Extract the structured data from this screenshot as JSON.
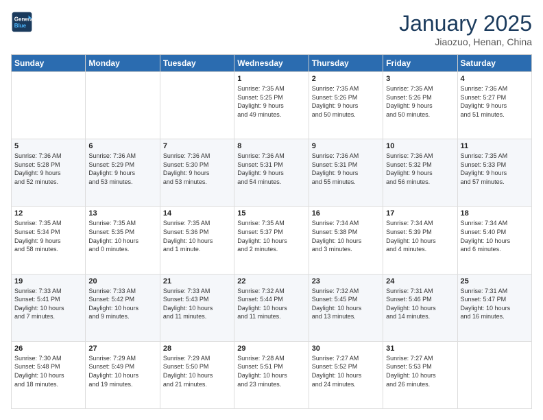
{
  "header": {
    "logo_line1": "General",
    "logo_line2": "Blue",
    "title": "January 2025",
    "subtitle": "Jiaozuo, Henan, China"
  },
  "weekdays": [
    "Sunday",
    "Monday",
    "Tuesday",
    "Wednesday",
    "Thursday",
    "Friday",
    "Saturday"
  ],
  "weeks": [
    [
      {
        "day": "",
        "info": ""
      },
      {
        "day": "",
        "info": ""
      },
      {
        "day": "",
        "info": ""
      },
      {
        "day": "1",
        "info": "Sunrise: 7:35 AM\nSunset: 5:25 PM\nDaylight: 9 hours\nand 49 minutes."
      },
      {
        "day": "2",
        "info": "Sunrise: 7:35 AM\nSunset: 5:26 PM\nDaylight: 9 hours\nand 50 minutes."
      },
      {
        "day": "3",
        "info": "Sunrise: 7:35 AM\nSunset: 5:26 PM\nDaylight: 9 hours\nand 50 minutes."
      },
      {
        "day": "4",
        "info": "Sunrise: 7:36 AM\nSunset: 5:27 PM\nDaylight: 9 hours\nand 51 minutes."
      }
    ],
    [
      {
        "day": "5",
        "info": "Sunrise: 7:36 AM\nSunset: 5:28 PM\nDaylight: 9 hours\nand 52 minutes."
      },
      {
        "day": "6",
        "info": "Sunrise: 7:36 AM\nSunset: 5:29 PM\nDaylight: 9 hours\nand 53 minutes."
      },
      {
        "day": "7",
        "info": "Sunrise: 7:36 AM\nSunset: 5:30 PM\nDaylight: 9 hours\nand 53 minutes."
      },
      {
        "day": "8",
        "info": "Sunrise: 7:36 AM\nSunset: 5:31 PM\nDaylight: 9 hours\nand 54 minutes."
      },
      {
        "day": "9",
        "info": "Sunrise: 7:36 AM\nSunset: 5:31 PM\nDaylight: 9 hours\nand 55 minutes."
      },
      {
        "day": "10",
        "info": "Sunrise: 7:36 AM\nSunset: 5:32 PM\nDaylight: 9 hours\nand 56 minutes."
      },
      {
        "day": "11",
        "info": "Sunrise: 7:35 AM\nSunset: 5:33 PM\nDaylight: 9 hours\nand 57 minutes."
      }
    ],
    [
      {
        "day": "12",
        "info": "Sunrise: 7:35 AM\nSunset: 5:34 PM\nDaylight: 9 hours\nand 58 minutes."
      },
      {
        "day": "13",
        "info": "Sunrise: 7:35 AM\nSunset: 5:35 PM\nDaylight: 10 hours\nand 0 minutes."
      },
      {
        "day": "14",
        "info": "Sunrise: 7:35 AM\nSunset: 5:36 PM\nDaylight: 10 hours\nand 1 minute."
      },
      {
        "day": "15",
        "info": "Sunrise: 7:35 AM\nSunset: 5:37 PM\nDaylight: 10 hours\nand 2 minutes."
      },
      {
        "day": "16",
        "info": "Sunrise: 7:34 AM\nSunset: 5:38 PM\nDaylight: 10 hours\nand 3 minutes."
      },
      {
        "day": "17",
        "info": "Sunrise: 7:34 AM\nSunset: 5:39 PM\nDaylight: 10 hours\nand 4 minutes."
      },
      {
        "day": "18",
        "info": "Sunrise: 7:34 AM\nSunset: 5:40 PM\nDaylight: 10 hours\nand 6 minutes."
      }
    ],
    [
      {
        "day": "19",
        "info": "Sunrise: 7:33 AM\nSunset: 5:41 PM\nDaylight: 10 hours\nand 7 minutes."
      },
      {
        "day": "20",
        "info": "Sunrise: 7:33 AM\nSunset: 5:42 PM\nDaylight: 10 hours\nand 9 minutes."
      },
      {
        "day": "21",
        "info": "Sunrise: 7:33 AM\nSunset: 5:43 PM\nDaylight: 10 hours\nand 11 minutes."
      },
      {
        "day": "22",
        "info": "Sunrise: 7:32 AM\nSunset: 5:44 PM\nDaylight: 10 hours\nand 11 minutes."
      },
      {
        "day": "23",
        "info": "Sunrise: 7:32 AM\nSunset: 5:45 PM\nDaylight: 10 hours\nand 13 minutes."
      },
      {
        "day": "24",
        "info": "Sunrise: 7:31 AM\nSunset: 5:46 PM\nDaylight: 10 hours\nand 14 minutes."
      },
      {
        "day": "25",
        "info": "Sunrise: 7:31 AM\nSunset: 5:47 PM\nDaylight: 10 hours\nand 16 minutes."
      }
    ],
    [
      {
        "day": "26",
        "info": "Sunrise: 7:30 AM\nSunset: 5:48 PM\nDaylight: 10 hours\nand 18 minutes."
      },
      {
        "day": "27",
        "info": "Sunrise: 7:29 AM\nSunset: 5:49 PM\nDaylight: 10 hours\nand 19 minutes."
      },
      {
        "day": "28",
        "info": "Sunrise: 7:29 AM\nSunset: 5:50 PM\nDaylight: 10 hours\nand 21 minutes."
      },
      {
        "day": "29",
        "info": "Sunrise: 7:28 AM\nSunset: 5:51 PM\nDaylight: 10 hours\nand 23 minutes."
      },
      {
        "day": "30",
        "info": "Sunrise: 7:27 AM\nSunset: 5:52 PM\nDaylight: 10 hours\nand 24 minutes."
      },
      {
        "day": "31",
        "info": "Sunrise: 7:27 AM\nSunset: 5:53 PM\nDaylight: 10 hours\nand 26 minutes."
      },
      {
        "day": "",
        "info": ""
      }
    ]
  ]
}
